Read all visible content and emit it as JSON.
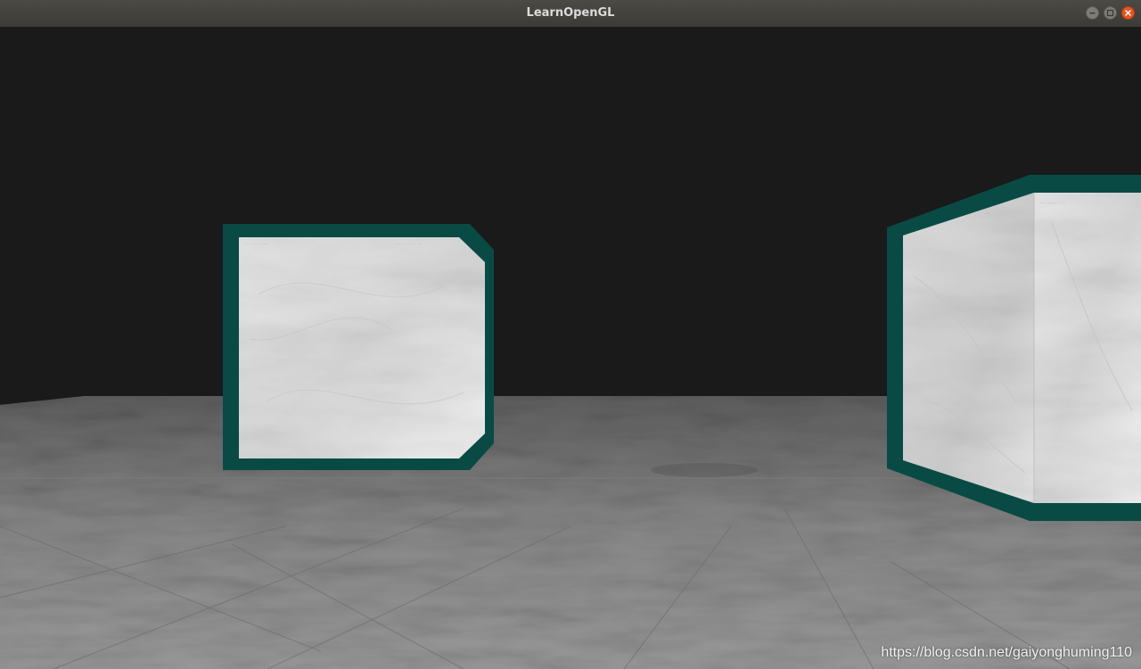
{
  "window": {
    "title": "LearnOpenGL"
  },
  "controls": {
    "minimize_icon": "minimize-icon",
    "maximize_icon": "maximize-icon",
    "close_icon": "close-icon"
  },
  "scene": {
    "background_color": "#1a1a1a",
    "outline_color": "#094a45",
    "floor_texture": "metal",
    "cube_texture": "marble"
  },
  "overlay": {
    "watermark": "https://blog.csdn.net/gaiyonghuming110"
  }
}
